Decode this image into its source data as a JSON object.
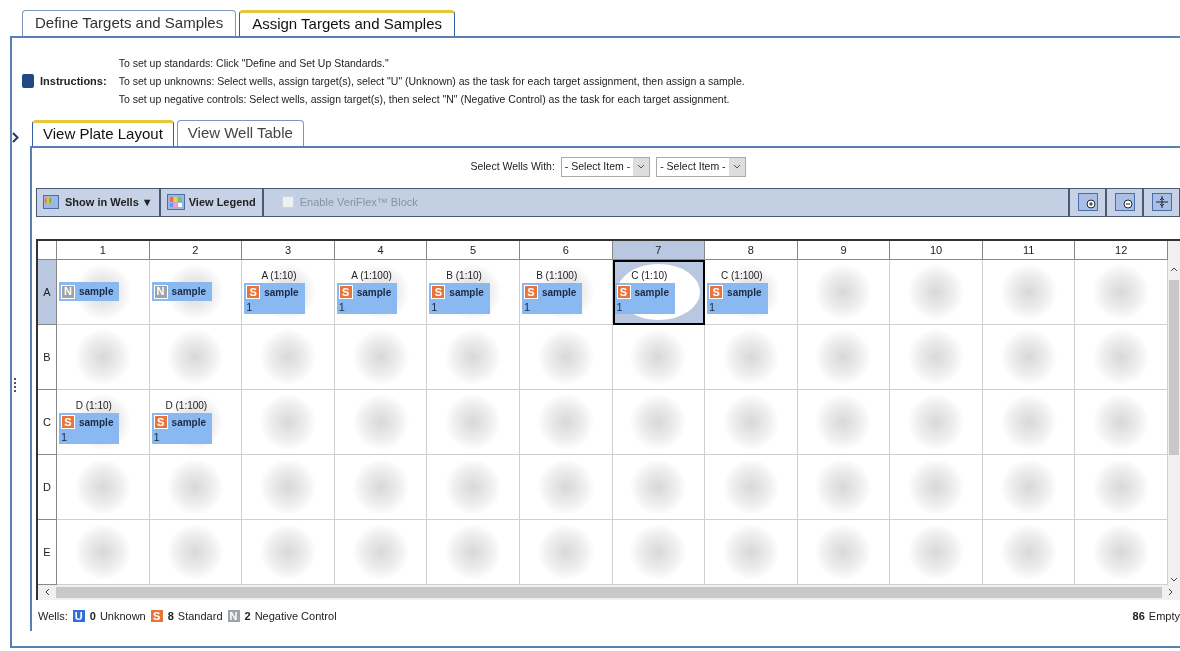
{
  "top_tabs": [
    {
      "label": "Define Targets and Samples",
      "selected": false
    },
    {
      "label": "Assign Targets and Samples",
      "selected": true
    }
  ],
  "instructions": {
    "label": "Instructions:",
    "lines": [
      "To set up standards: Click \"Define and Set Up Standards.\"",
      "To set up unknowns: Select wells, assign target(s), select \"U\" (Unknown) as the task for each target assignment, then assign a sample.",
      "To set up negative controls: Select wells, assign target(s), then select \"N\" (Negative Control) as the task for each target assignment."
    ]
  },
  "view_tabs": [
    {
      "label": "View Plate Layout",
      "selected": true
    },
    {
      "label": "View Well Table",
      "selected": false
    }
  ],
  "select_wells": {
    "label": "Select Wells With:",
    "dropdowns": [
      "- Select Item -",
      "- Select Item -"
    ]
  },
  "toolbar": {
    "show_in_wells": "Show in Wells ▼",
    "view_legend": "View Legend",
    "veriflex": {
      "label": "Enable VeriFlex™ Block",
      "checked": false,
      "disabled": true
    }
  },
  "plate": {
    "columns": [
      {
        "label": "1",
        "selected": false
      },
      {
        "label": "2",
        "selected": false
      },
      {
        "label": "3",
        "selected": false
      },
      {
        "label": "4",
        "selected": false
      },
      {
        "label": "5",
        "selected": false
      },
      {
        "label": "6",
        "selected": false
      },
      {
        "label": "7",
        "selected": true
      },
      {
        "label": "8",
        "selected": false
      },
      {
        "label": "9",
        "selected": false
      },
      {
        "label": "10",
        "selected": false
      },
      {
        "label": "11",
        "selected": false
      },
      {
        "label": "12",
        "selected": false
      }
    ],
    "rows": [
      {
        "label": "A",
        "selected": true,
        "wells": [
          {
            "kind": "negative",
            "badge": "N",
            "sample": "sample",
            "selected": false
          },
          {
            "kind": "negative",
            "badge": "N",
            "sample": "sample",
            "selected": false
          },
          {
            "kind": "standard",
            "target": "A  (1:10)",
            "badge": "S",
            "sample": "sample",
            "quantity": "1",
            "selected": false
          },
          {
            "kind": "standard",
            "target": "A (1:100)",
            "badge": "S",
            "sample": "sample",
            "quantity": "1",
            "selected": false
          },
          {
            "kind": "standard",
            "target": "B (1:10)",
            "badge": "S",
            "sample": "sample",
            "quantity": "1",
            "selected": false
          },
          {
            "kind": "standard",
            "target": "B (1:100)",
            "badge": "S",
            "sample": "sample",
            "quantity": "1",
            "selected": false
          },
          {
            "kind": "standard",
            "target": "C (1:10)",
            "badge": "S",
            "sample": "sample",
            "quantity": "1",
            "selected": true
          },
          {
            "kind": "standard",
            "target": "C (1:100)",
            "badge": "S",
            "sample": "sample",
            "quantity": "1",
            "selected": false
          },
          {
            "kind": "empty",
            "selected": false
          },
          {
            "kind": "empty",
            "selected": false
          },
          {
            "kind": "empty",
            "selected": false
          },
          {
            "kind": "empty",
            "selected": false
          }
        ]
      },
      {
        "label": "B",
        "selected": false,
        "wells": [
          {
            "kind": "empty",
            "selected": false
          },
          {
            "kind": "empty",
            "selected": false
          },
          {
            "kind": "empty",
            "selected": false
          },
          {
            "kind": "empty",
            "selected": false
          },
          {
            "kind": "empty",
            "selected": false
          },
          {
            "kind": "empty",
            "selected": false
          },
          {
            "kind": "empty",
            "selected": false
          },
          {
            "kind": "empty",
            "selected": false
          },
          {
            "kind": "empty",
            "selected": false
          },
          {
            "kind": "empty",
            "selected": false
          },
          {
            "kind": "empty",
            "selected": false
          },
          {
            "kind": "empty",
            "selected": false
          }
        ]
      },
      {
        "label": "C",
        "selected": false,
        "wells": [
          {
            "kind": "standard",
            "target": "D (1:10)",
            "badge": "S",
            "sample": "sample",
            "quantity": "1",
            "selected": false
          },
          {
            "kind": "standard",
            "target": "D (1:100)",
            "badge": "S",
            "sample": "sample",
            "quantity": "1",
            "selected": false
          },
          {
            "kind": "empty",
            "selected": false
          },
          {
            "kind": "empty",
            "selected": false
          },
          {
            "kind": "empty",
            "selected": false
          },
          {
            "kind": "empty",
            "selected": false
          },
          {
            "kind": "empty",
            "selected": false
          },
          {
            "kind": "empty",
            "selected": false
          },
          {
            "kind": "empty",
            "selected": false
          },
          {
            "kind": "empty",
            "selected": false
          },
          {
            "kind": "empty",
            "selected": false
          },
          {
            "kind": "empty",
            "selected": false
          }
        ]
      },
      {
        "label": "D",
        "selected": false,
        "wells": [
          {
            "kind": "empty",
            "selected": false
          },
          {
            "kind": "empty",
            "selected": false
          },
          {
            "kind": "empty",
            "selected": false
          },
          {
            "kind": "empty",
            "selected": false
          },
          {
            "kind": "empty",
            "selected": false
          },
          {
            "kind": "empty",
            "selected": false
          },
          {
            "kind": "empty",
            "selected": false
          },
          {
            "kind": "empty",
            "selected": false
          },
          {
            "kind": "empty",
            "selected": false
          },
          {
            "kind": "empty",
            "selected": false
          },
          {
            "kind": "empty",
            "selected": false
          },
          {
            "kind": "empty",
            "selected": false
          }
        ]
      },
      {
        "label": "E",
        "selected": false,
        "wells": [
          {
            "kind": "empty",
            "selected": false
          },
          {
            "kind": "empty",
            "selected": false
          },
          {
            "kind": "empty",
            "selected": false
          },
          {
            "kind": "empty",
            "selected": false
          },
          {
            "kind": "empty",
            "selected": false
          },
          {
            "kind": "empty",
            "selected": false
          },
          {
            "kind": "empty",
            "selected": false
          },
          {
            "kind": "empty",
            "selected": false
          },
          {
            "kind": "empty",
            "selected": false
          },
          {
            "kind": "empty",
            "selected": false
          },
          {
            "kind": "empty",
            "selected": false
          },
          {
            "kind": "empty",
            "selected": false
          }
        ]
      }
    ]
  },
  "footer": {
    "label": "Wells:",
    "counts": [
      {
        "kind": "unknown",
        "badge": "U",
        "count": "0",
        "label": "Unknown"
      },
      {
        "kind": "standard",
        "badge": "S",
        "count": "8",
        "label": "Standard"
      },
      {
        "kind": "negative",
        "badge": "N",
        "count": "2",
        "label": "Negative Control"
      }
    ],
    "empty": {
      "count": "86",
      "label": "Empty"
    }
  }
}
